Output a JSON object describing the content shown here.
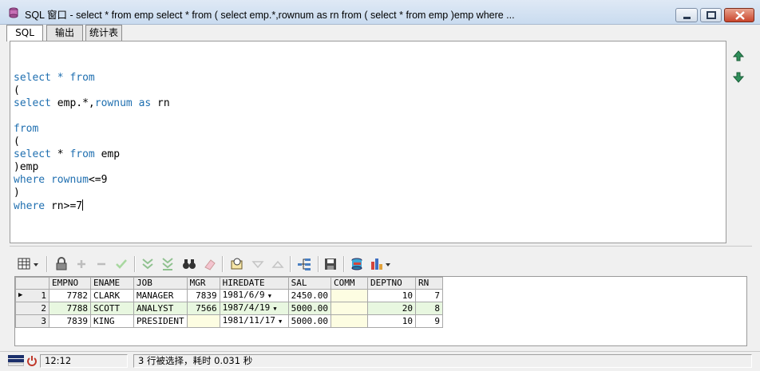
{
  "window": {
    "title": "SQL 窗口 - select * from emp select * from ( select emp.*,rownum as rn from ( select * from emp )emp where  ..."
  },
  "tabs": [
    {
      "label": "SQL",
      "active": true
    },
    {
      "label": "输出",
      "active": false
    },
    {
      "label": "统计表",
      "active": false
    }
  ],
  "editor": {
    "lines": [
      "",
      "select * from",
      "(",
      "select emp.*,rownum as rn",
      "",
      "from",
      "(",
      "select * from emp",
      ")emp",
      "where rownum<=9",
      ")",
      "where rn>=7"
    ]
  },
  "grid": {
    "columns": [
      "",
      "EMPNO",
      "ENAME",
      "JOB",
      "MGR",
      "HIREDATE",
      "SAL",
      "COMM",
      "DEPTNO",
      "RN"
    ],
    "rows": [
      {
        "row_num": "1",
        "empno": "7782",
        "ename": "CLARK",
        "job": "MANAGER",
        "mgr": "7839",
        "hiredate": "1981/6/9",
        "sal": "2450.00",
        "comm": "",
        "deptno": "10",
        "rn": "7"
      },
      {
        "row_num": "2",
        "empno": "7788",
        "ename": "SCOTT",
        "job": "ANALYST",
        "mgr": "7566",
        "hiredate": "1987/4/19",
        "sal": "5000.00",
        "comm": "",
        "deptno": "20",
        "rn": "8"
      },
      {
        "row_num": "3",
        "empno": "7839",
        "ename": "KING",
        "job": "PRESIDENT",
        "mgr": "",
        "hiredate": "1981/11/17",
        "sal": "5000.00",
        "comm": "",
        "deptno": "10",
        "rn": "9"
      }
    ],
    "row_alt_color": "#e8f7e0"
  },
  "statusbar": {
    "position": "12:12",
    "message": "3 行被选择，耗时 0.031 秒"
  },
  "colors": {
    "keyword": "#1f6fb0",
    "titlebar": "#dfe9f5"
  }
}
